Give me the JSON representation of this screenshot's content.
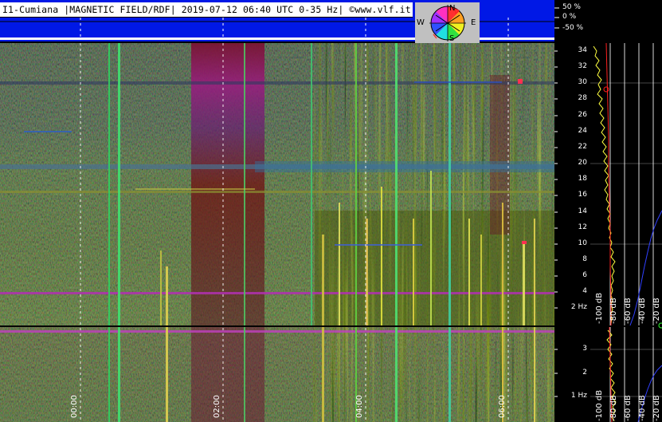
{
  "header": {
    "title": "I1-Cumiana |MAGNETIC FIELD/RDF| 2019-07-12 06:40 UTC 0-35 Hz| ©www.vlf.it"
  },
  "direction_scale": {
    "ticks": [
      "50 %",
      "0 %",
      "-50 %"
    ]
  },
  "compass": {
    "north": "N",
    "south": "S",
    "east": "E",
    "west": "W"
  },
  "upper_panel": {
    "freq_ticks": [
      "34",
      "32",
      "30",
      "28",
      "26",
      "24",
      "22",
      "20",
      "18",
      "16",
      "14",
      "12",
      "10",
      "8",
      "6",
      "4",
      "2 Hz"
    ]
  },
  "lower_panel": {
    "freq_ticks": [
      "3",
      "2",
      "1 Hz"
    ]
  },
  "time_axis": {
    "ticks": [
      "00:00",
      "02:00",
      "04:00",
      "06:00"
    ]
  },
  "level_axis": {
    "ticks": [
      "-100 dB",
      "-80 dB",
      "-60 dB",
      "-40 dB",
      "-20 dB"
    ]
  },
  "colors": {
    "header_blue": "#0018e6",
    "trace_yellow": "#ffff40",
    "trace_red": "#ff2020"
  }
}
